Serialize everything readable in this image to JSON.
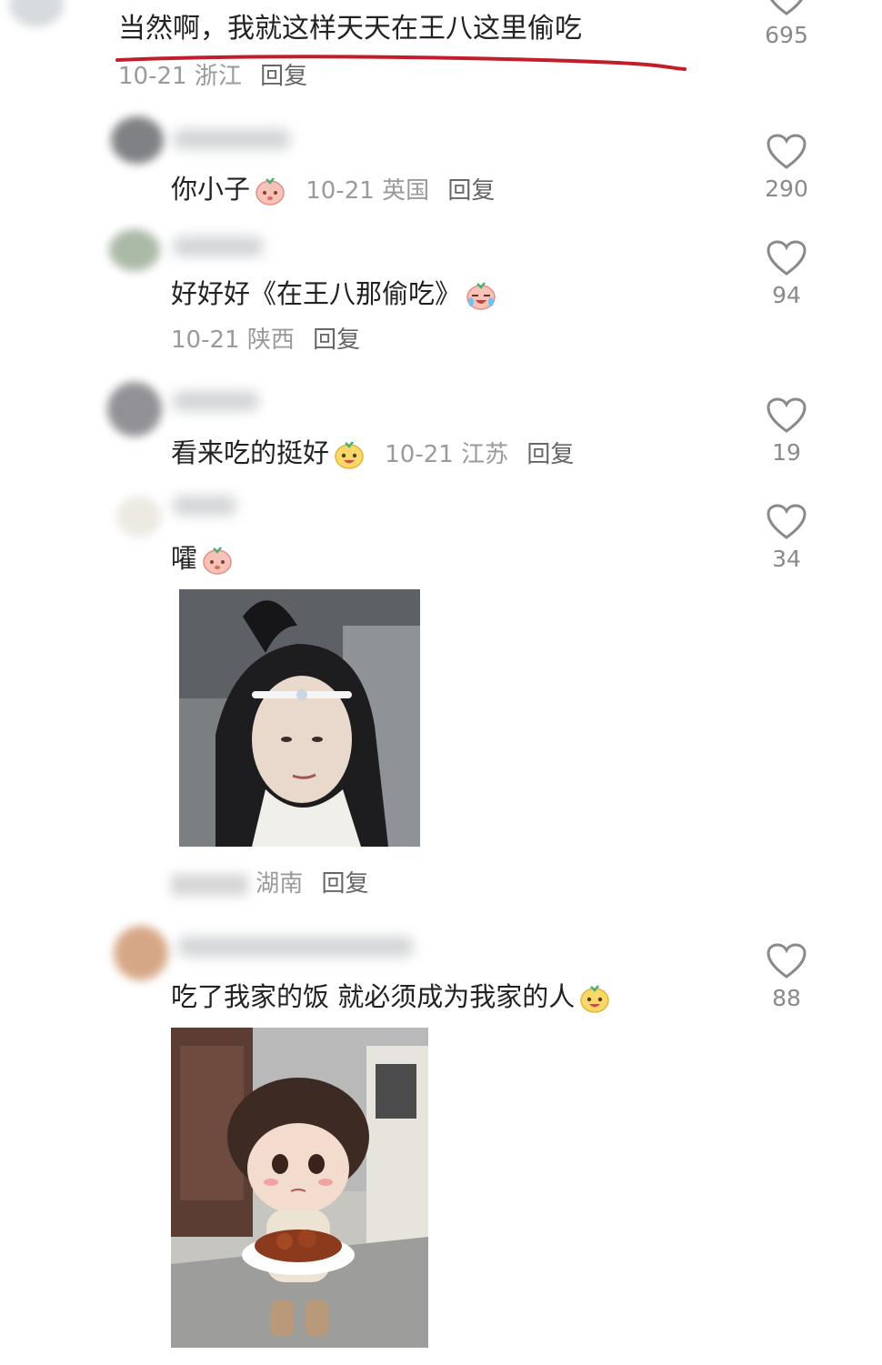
{
  "top_comment": {
    "text": "当然啊，我就这样天天在王八这里偷吃",
    "date": "10-21",
    "location": "浙江",
    "reply_label": "回复",
    "likes": "695"
  },
  "replies": [
    {
      "text": "你小子",
      "date": "10-21",
      "location": "英国",
      "reply_label": "回复",
      "likes": "290",
      "emoji": "shy-face-icon"
    },
    {
      "text": "好好好《在王八那偷吃》",
      "date": "10-21",
      "location": "陕西",
      "reply_label": "回复",
      "likes": "94",
      "emoji": "crying-laugh-icon"
    },
    {
      "text": "看来吃的挺好",
      "date": "10-21",
      "location": "江苏",
      "reply_label": "回复",
      "likes": "19",
      "emoji": "yellow-smile-icon"
    },
    {
      "text": "嚯",
      "location": "湖南",
      "reply_label": "回复",
      "likes": "34",
      "emoji": "shy-face-icon"
    },
    {
      "text": "吃了我家的饭 就必须成为我家的人",
      "likes": "88",
      "emoji": "yellow-smile-icon"
    }
  ],
  "icons": {
    "like": "heart-outline-icon"
  },
  "colors": {
    "underline": "#c21e2a",
    "text": "#222222",
    "meta": "#9a9a9a"
  }
}
